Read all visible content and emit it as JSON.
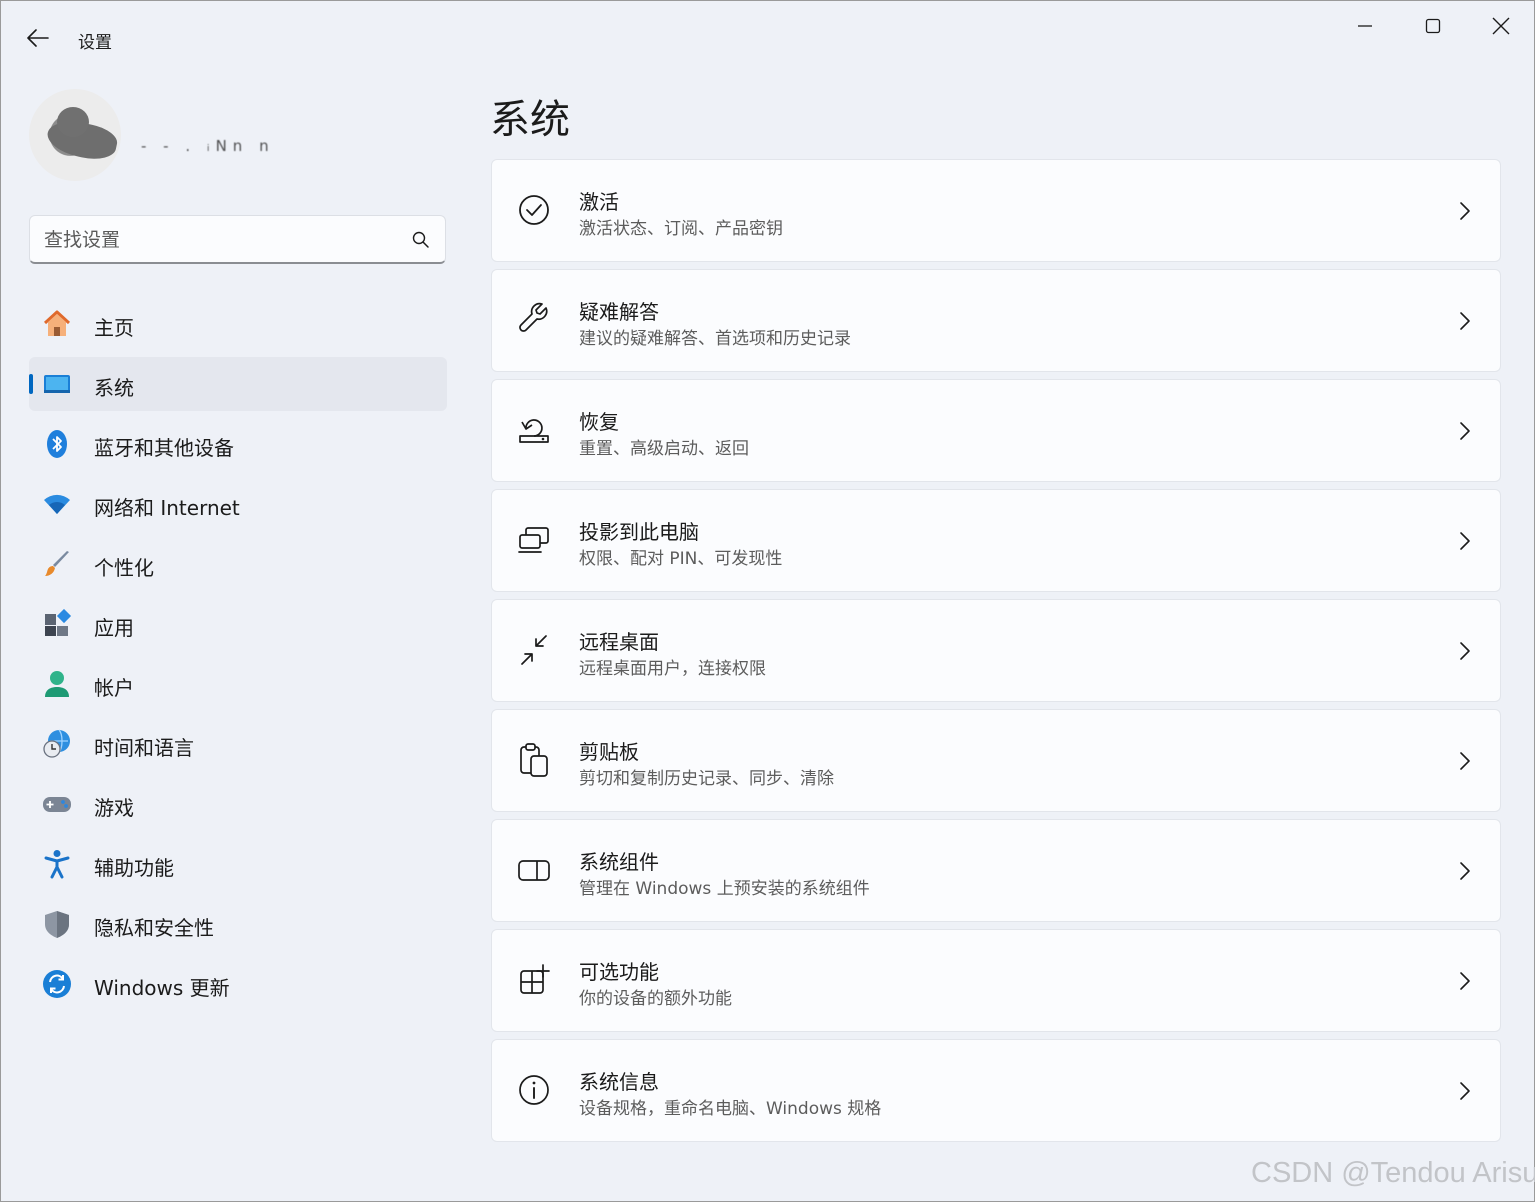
{
  "window": {
    "title": "设置"
  },
  "profile": {
    "name": "- - . ᵢNn n"
  },
  "search": {
    "placeholder": "查找设置"
  },
  "sidebar": {
    "items": [
      {
        "label": "主页",
        "icon": "home-icon",
        "active": false
      },
      {
        "label": "系统",
        "icon": "system-display-icon",
        "active": true
      },
      {
        "label": "蓝牙和其他设备",
        "icon": "bluetooth-icon",
        "active": false
      },
      {
        "label": "网络和 Internet",
        "icon": "wifi-icon",
        "active": false
      },
      {
        "label": "个性化",
        "icon": "paintbrush-icon",
        "active": false
      },
      {
        "label": "应用",
        "icon": "apps-icon",
        "active": false
      },
      {
        "label": "帐户",
        "icon": "account-icon",
        "active": false
      },
      {
        "label": "时间和语言",
        "icon": "time-language-icon",
        "active": false
      },
      {
        "label": "游戏",
        "icon": "gamepad-icon",
        "active": false
      },
      {
        "label": "辅助功能",
        "icon": "accessibility-icon",
        "active": false
      },
      {
        "label": "隐私和安全性",
        "icon": "shield-icon",
        "active": false
      },
      {
        "label": "Windows 更新",
        "icon": "windows-update-icon",
        "active": false
      }
    ]
  },
  "main": {
    "title": "系统",
    "cards": [
      {
        "title": "激活",
        "desc": "激活状态、订阅、产品密钥",
        "icon": "check-circle-icon"
      },
      {
        "title": "疑难解答",
        "desc": "建议的疑难解答、首选项和历史记录",
        "icon": "wrench-icon"
      },
      {
        "title": "恢复",
        "desc": "重置、高级启动、返回",
        "icon": "recovery-icon"
      },
      {
        "title": "投影到此电脑",
        "desc": "权限、配对 PIN、可发现性",
        "icon": "project-icon"
      },
      {
        "title": "远程桌面",
        "desc": "远程桌面用户，连接权限",
        "icon": "remote-desktop-icon"
      },
      {
        "title": "剪贴板",
        "desc": "剪切和复制历史记录、同步、清除",
        "icon": "clipboard-icon"
      },
      {
        "title": "系统组件",
        "desc": "管理在 Windows 上预安装的系统组件",
        "icon": "system-components-icon"
      },
      {
        "title": "可选功能",
        "desc": "你的设备的额外功能",
        "icon": "optional-features-icon"
      },
      {
        "title": "系统信息",
        "desc": "设备规格，重命名电脑、Windows 规格",
        "icon": "info-icon"
      }
    ]
  },
  "watermark": "CSDN @Tendou Arisu",
  "colors": {
    "accent": "#0067c0",
    "background": "#eef1f7",
    "card": "#fbfcfe"
  }
}
